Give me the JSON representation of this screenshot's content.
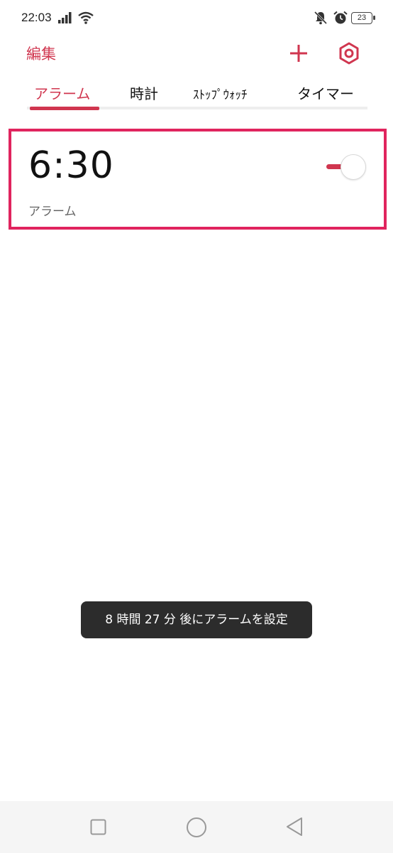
{
  "status_bar": {
    "time": "22:03",
    "battery": "23"
  },
  "header": {
    "edit_label": "編集",
    "add_icon": "plus-icon",
    "settings_icon": "settings-icon"
  },
  "tabs": [
    {
      "label": "アラーム",
      "active": true
    },
    {
      "label": "時計",
      "active": false
    },
    {
      "label": "ｽﾄｯﾌﾟｳｫｯﾁ",
      "active": false
    },
    {
      "label": "タイマー",
      "active": false
    }
  ],
  "alarms": [
    {
      "time": "6:30",
      "label": "アラーム",
      "enabled": true
    }
  ],
  "toast": {
    "message": "8 時間 27 分 後にアラームを設定"
  },
  "colors": {
    "accent": "#d0364f",
    "highlight": "#e0245e",
    "toast_bg": "#2c2c2c"
  }
}
